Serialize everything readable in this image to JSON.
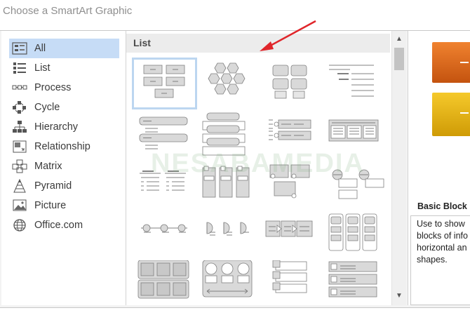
{
  "dialog": {
    "title": "Choose a SmartArt Graphic"
  },
  "categories": [
    {
      "label": "All",
      "icon": "all-icon",
      "selected": true
    },
    {
      "label": "List",
      "icon": "list-icon"
    },
    {
      "label": "Process",
      "icon": "process-icon"
    },
    {
      "label": "Cycle",
      "icon": "cycle-icon"
    },
    {
      "label": "Hierarchy",
      "icon": "hierarchy-icon"
    },
    {
      "label": "Relationship",
      "icon": "relationship-icon"
    },
    {
      "label": "Matrix",
      "icon": "matrix-icon"
    },
    {
      "label": "Pyramid",
      "icon": "pyramid-icon"
    },
    {
      "label": "Picture",
      "icon": "picture-icon"
    },
    {
      "label": "Office.com",
      "icon": "globe-icon"
    }
  ],
  "gallery": {
    "section_label": "List",
    "selected_index": 0
  },
  "preview": {
    "title": "Basic Block L",
    "description_lines": [
      "Use to show",
      "blocks of info",
      "horizontal an",
      "shapes."
    ]
  },
  "watermark": "NESABAMEDIA",
  "colors": {
    "selection": "#c6dcf6",
    "arrow": "#e0262b",
    "orange": "#e86e1f",
    "gold": "#f0bb17"
  }
}
